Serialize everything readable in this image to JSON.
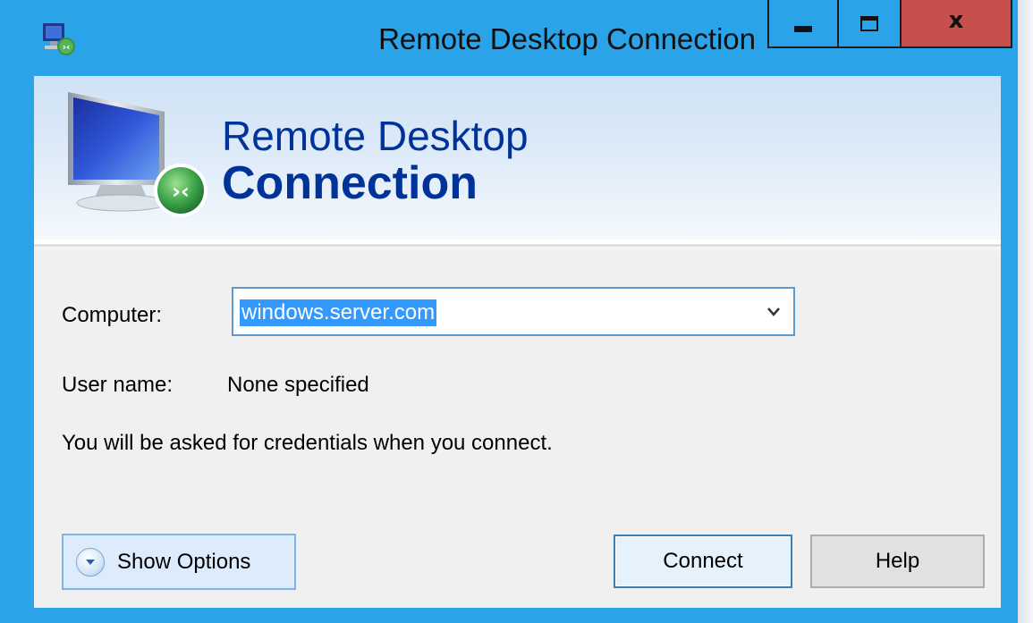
{
  "window": {
    "title": "Remote Desktop Connection",
    "controls": {
      "minimize": "minimize",
      "maximize": "maximize",
      "close": "close"
    }
  },
  "banner": {
    "line1": "Remote Desktop",
    "line2": "Connection",
    "graphic_icon": "remote-desktop-monitor-icon"
  },
  "form": {
    "computer_label": "Computer:",
    "computer_value": "windows.server.com",
    "username_label": "User name:",
    "username_value": "None specified",
    "credentials_note": "You will be asked for credentials when you connect."
  },
  "buttons": {
    "show_options": "Show Options",
    "connect": "Connect",
    "help": "Help"
  },
  "colors": {
    "title_bar": "#2aa3e8",
    "close_button": "#c74f4c",
    "banner_text": "#003399",
    "selection": "#3399ff"
  }
}
